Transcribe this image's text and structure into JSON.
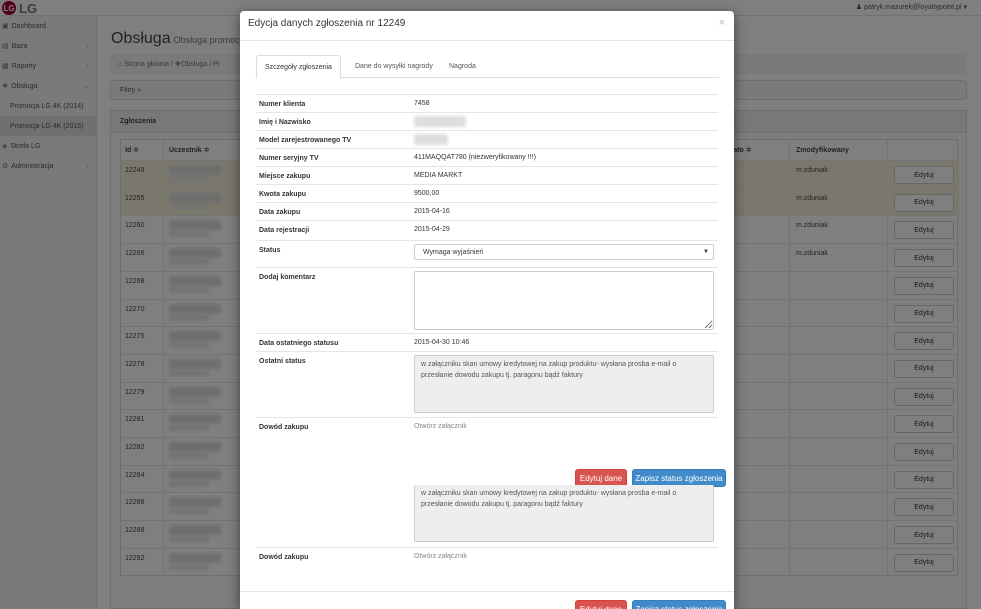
{
  "brand": {
    "logo_mark": "LG",
    "logo_text": "LG"
  },
  "user": {
    "email": "patryk.mazurek@loyaltypoint.pl"
  },
  "sidebar": {
    "items": [
      {
        "label": "Dashboard",
        "icon": "dashboard-icon"
      },
      {
        "label": "Baza",
        "icon": "database-icon"
      },
      {
        "label": "Raporty",
        "icon": "chart-icon"
      },
      {
        "label": "Obsługa",
        "icon": "wrench-icon"
      },
      {
        "label": "Promocja LG 4K (2014)"
      },
      {
        "label": "Promocja LG 4K (2015)"
      },
      {
        "label": "Strefa LG",
        "icon": "globe-icon"
      },
      {
        "label": "Administracja",
        "icon": "gear-icon"
      }
    ]
  },
  "page": {
    "title": "Obsługa",
    "subtitle": "Obsługa promocji L",
    "breadcrumb": [
      "Strona główna",
      "Obsługa",
      "Pr"
    ],
    "filters_label": "Filtry »",
    "panel_title": "Zgłoszenia"
  },
  "table": {
    "headers": {
      "id": "Id ≑",
      "participant": "Uczestnik ≑",
      "status": "tato ≑",
      "modified": "Zmodyfikowany"
    },
    "edit_label": "Edytuj",
    "rows": [
      {
        "id": "12249",
        "modified": "m.zduniak"
      },
      {
        "id": "12255",
        "modified": "m.zduniak"
      },
      {
        "id": "12260",
        "modified": "m.zduniak"
      },
      {
        "id": "12266",
        "modified": "m.zduniak"
      },
      {
        "id": "12268",
        "modified": ""
      },
      {
        "id": "12270",
        "modified": ""
      },
      {
        "id": "12275",
        "modified": ""
      },
      {
        "id": "12278",
        "modified": ""
      },
      {
        "id": "12279",
        "modified": ""
      },
      {
        "id": "12281",
        "modified": ""
      },
      {
        "id": "12282",
        "modified": ""
      },
      {
        "id": "12284",
        "modified": ""
      },
      {
        "id": "12286",
        "modified": ""
      },
      {
        "id": "12288",
        "modified": ""
      },
      {
        "id": "12292",
        "modified": ""
      }
    ]
  },
  "modal": {
    "title": "Edycja danych zgłoszenia nr 12249",
    "close": "×",
    "tabs": [
      "Szczegóły zgłoszenia",
      "Dane do wysyłki nagrody",
      "Nagroda"
    ],
    "fields": {
      "client_no_label": "Numer klienta",
      "client_no": "7458",
      "name_label": "Imię i Nazwisko",
      "model_label": "Model zarejestrowanego TV",
      "serial_label": "Numer seryjny TV",
      "serial": "411MAQQAT780 (niezweryfikowany !!!)",
      "place_label": "Miejsce zakupu",
      "place": "MEDIA MARKT",
      "amount_label": "Kwota zakupu",
      "amount": "9500,00",
      "purchase_date_label": "Data zakupu",
      "purchase_date": "2015-04-16",
      "reg_date_label": "Data rejestracji",
      "reg_date": "2015-04-29",
      "status_label": "Status",
      "status": "Wymaga wyjaśnień",
      "comment_label": "Dodaj komentarz",
      "comment": "",
      "last_status_date_label": "Data ostatniego statusu",
      "last_status_date": "2015-04-30 10:46",
      "last_status_label": "Ostatni status",
      "last_status_text": "w załączniku skan umowy kredytowej na zakup produktu- wysłana prosba e-mail o przesłanie dowodu zakupu tj. paragonu bądź faktury",
      "proof_label": "Dowód zakupu",
      "proof_link": "Otwórz załącznik"
    },
    "buttons": {
      "edit": "Edytuj dane",
      "save": "Zapisz status zgłoszenia"
    }
  },
  "colors": {
    "btn_red": "#d9534f",
    "btn_blue": "#428bca",
    "row_highlight": "#f5f1d9"
  }
}
